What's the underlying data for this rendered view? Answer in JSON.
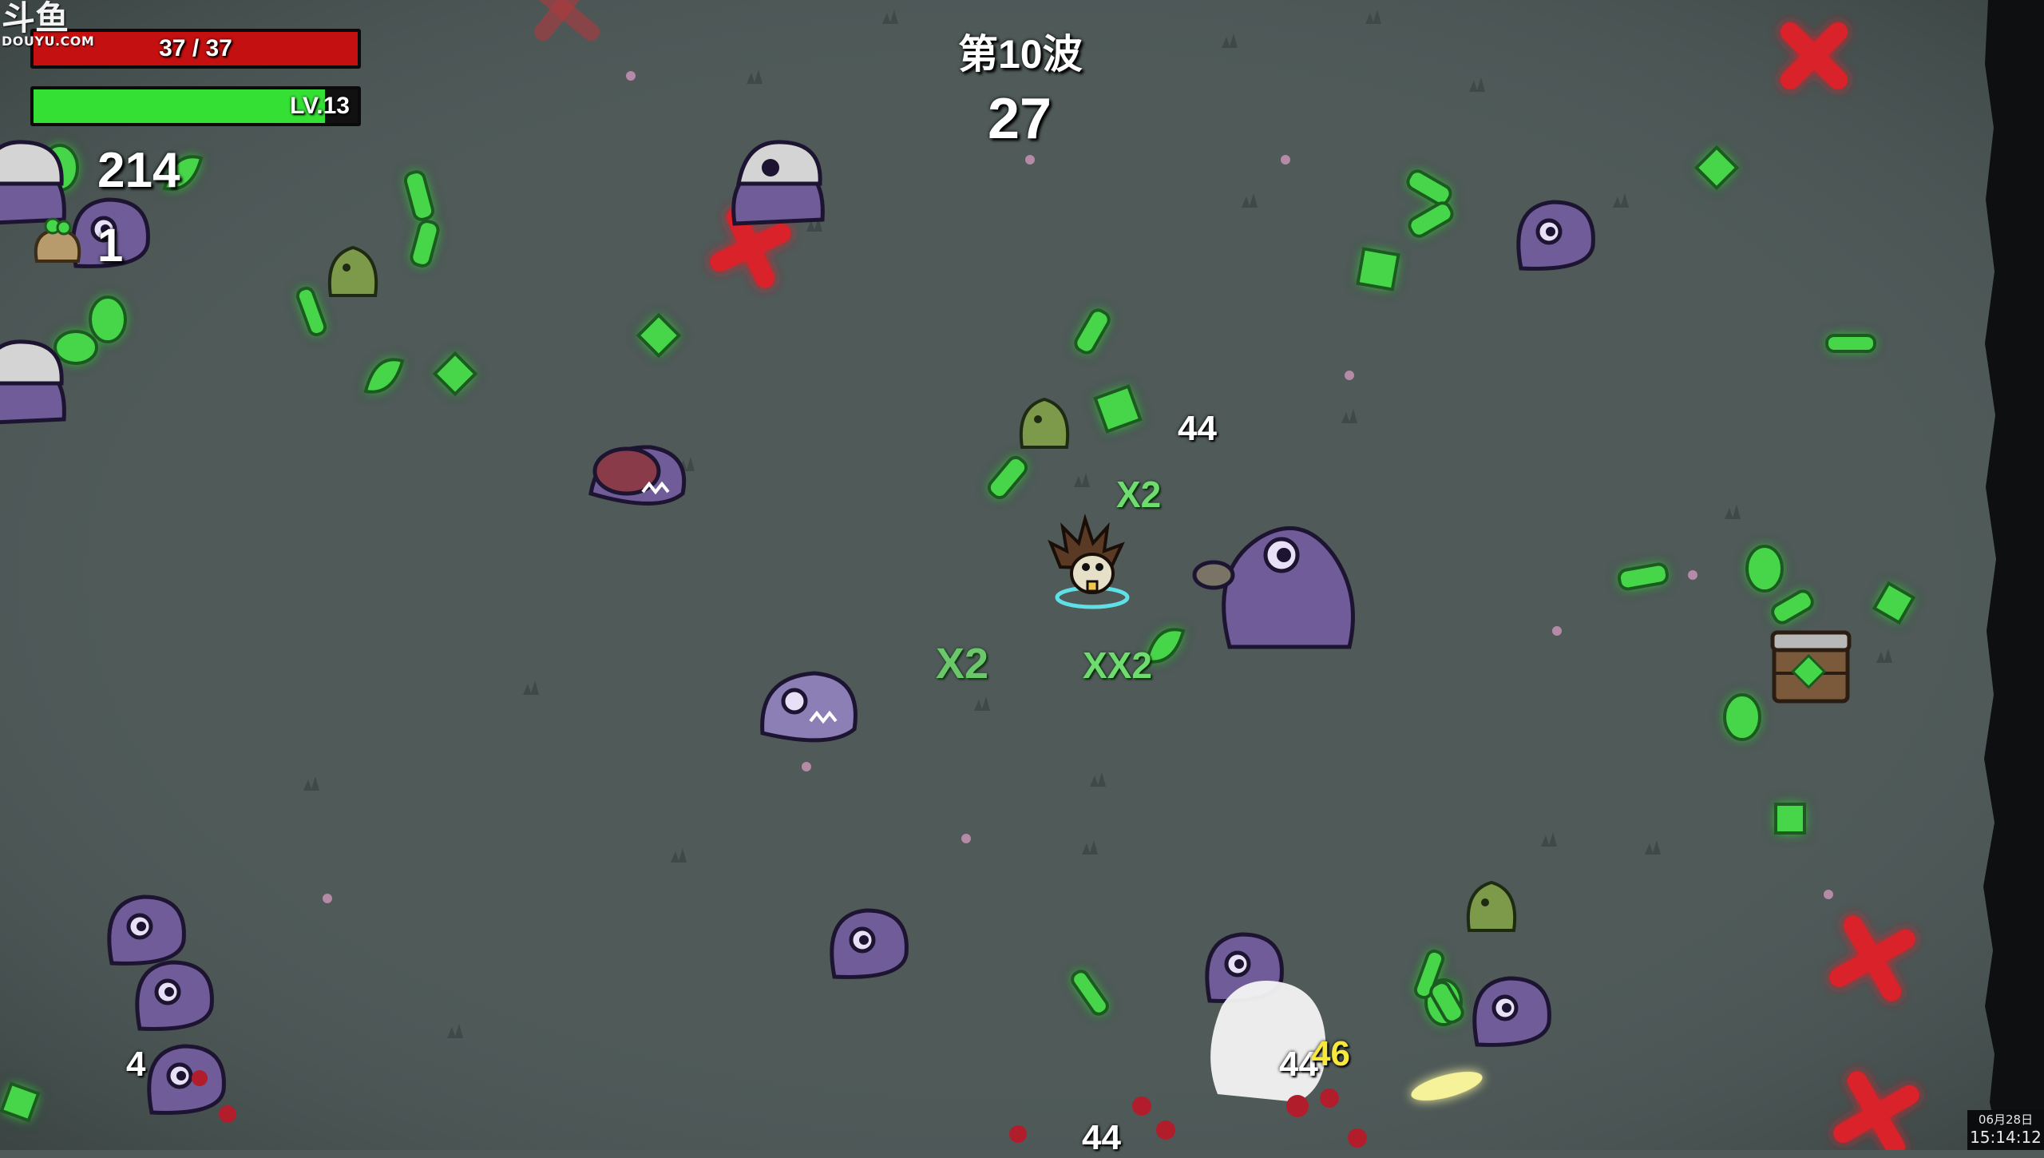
{
  "watermark": {
    "main": "斗鱼",
    "sub": "DOUYU.COM"
  },
  "hud": {
    "hp": {
      "text": "37 / 37",
      "current": 37,
      "max": 37,
      "fill_color": "#c41010"
    },
    "xp": {
      "text": "LV.13",
      "fill_fraction": 0.9,
      "fill_color": "#35e035"
    },
    "materials": "214",
    "bag_count": "1"
  },
  "wave": {
    "label": "第10波",
    "timer": "27"
  },
  "floating_numbers": {
    "dmg_center": "44",
    "dmg_bottom_a": "44",
    "dmg_bottom_b": "46",
    "dmg_bottom_c": "44",
    "left_count": "4"
  },
  "multipliers": {
    "m1": "X2",
    "m2": "X2",
    "m3": "XX2"
  },
  "clock": {
    "date": "06月28日",
    "time": "15:14:12"
  },
  "colors": {
    "ground": "#4f5a59",
    "enemy": "#6f5c98",
    "material": "#46d64a",
    "danger": "#d9202c"
  }
}
